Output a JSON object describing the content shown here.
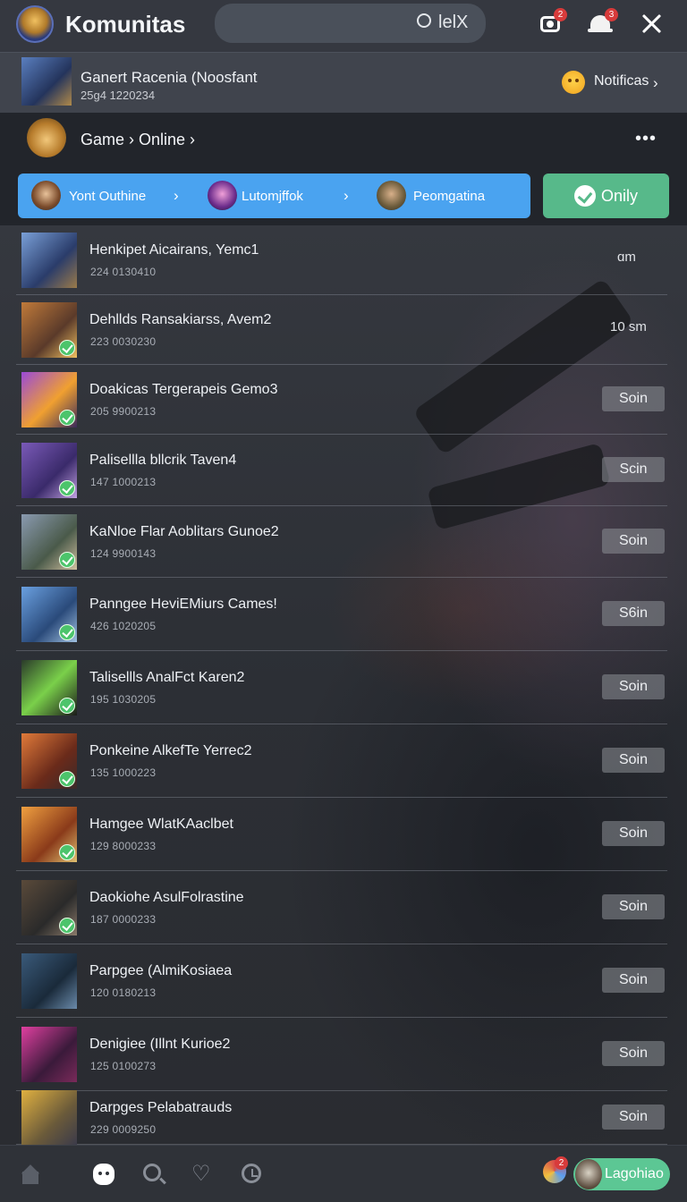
{
  "header": {
    "title": "Komunitas",
    "search_text": "lelX",
    "camera_badge": "2",
    "bell_badge": "3"
  },
  "featured": {
    "title": "Ganert Racenia (Noosfant",
    "subtitle": "25g4 1220234",
    "notif_label": "Notificas",
    "notif_chevron": "›"
  },
  "breadcrumb": {
    "text": "Game › Online ›",
    "more": "•••"
  },
  "filters": {
    "chips": [
      {
        "label": "Yont Outhine",
        "arrow": "›"
      },
      {
        "label": "Lutomjffok",
        "arrow": "›"
      },
      {
        "label": "Peomgatina",
        "arrow": ""
      }
    ],
    "only_label": "Onily"
  },
  "list": [
    {
      "title": "Henkipet Aicairans, Yemc1",
      "sub": "224 0130410",
      "right": "ɑm",
      "kind": "time"
    },
    {
      "title": "Dehllds Ransakiarss, Avem2",
      "sub": "223 0030230",
      "right": "10 sm",
      "kind": "time"
    },
    {
      "title": "Doakicas Tergerapeis Gemo3",
      "sub": "205 9900213",
      "right": "Soin",
      "kind": "button"
    },
    {
      "title": "Palisellla bllcrik Taven4",
      "sub": "147 1000213",
      "right": "Scin",
      "kind": "button"
    },
    {
      "title": "KaNloe Flar Aoblitars Gunoe2",
      "sub": "124 9900143",
      "right": "Soin",
      "kind": "button"
    },
    {
      "title": "Panngee HeviEMiurs Cames!",
      "sub": "426 1020205",
      "right": "S6in",
      "kind": "button"
    },
    {
      "title": "Talisellls AnalFct Karen2",
      "sub": "195 1030205",
      "right": "Soin",
      "kind": "button"
    },
    {
      "title": "Ponkeine AlkefTe Yerrec2",
      "sub": "135 1000223",
      "right": "Soin",
      "kind": "button"
    },
    {
      "title": "Hamgee WlatKAaclbet",
      "sub": "129 8000233",
      "right": "Soin",
      "kind": "button"
    },
    {
      "title": "Daokiohe AsulFolrastine",
      "sub": "187 0000233",
      "right": "Soin",
      "kind": "button"
    },
    {
      "title": "Parpgee (AlmiKosiaea",
      "sub": "120 0180213",
      "right": "Soin",
      "kind": "button"
    },
    {
      "title": "Denigiee (Illnt Kurioe2",
      "sub": "125 0100273",
      "right": "Soin",
      "kind": "button"
    },
    {
      "title": "Darpges Pelabatrauds",
      "sub": "229 0009250",
      "right": "Soin",
      "kind": "button"
    }
  ],
  "bottom_nav": {
    "mini_badge": "2",
    "login_label": "Lagohiao"
  },
  "colors": {
    "accent_blue": "#4aa3f0",
    "accent_green": "#57b98a",
    "check_green": "#4cc46b",
    "badge_red": "#d83b3b"
  }
}
